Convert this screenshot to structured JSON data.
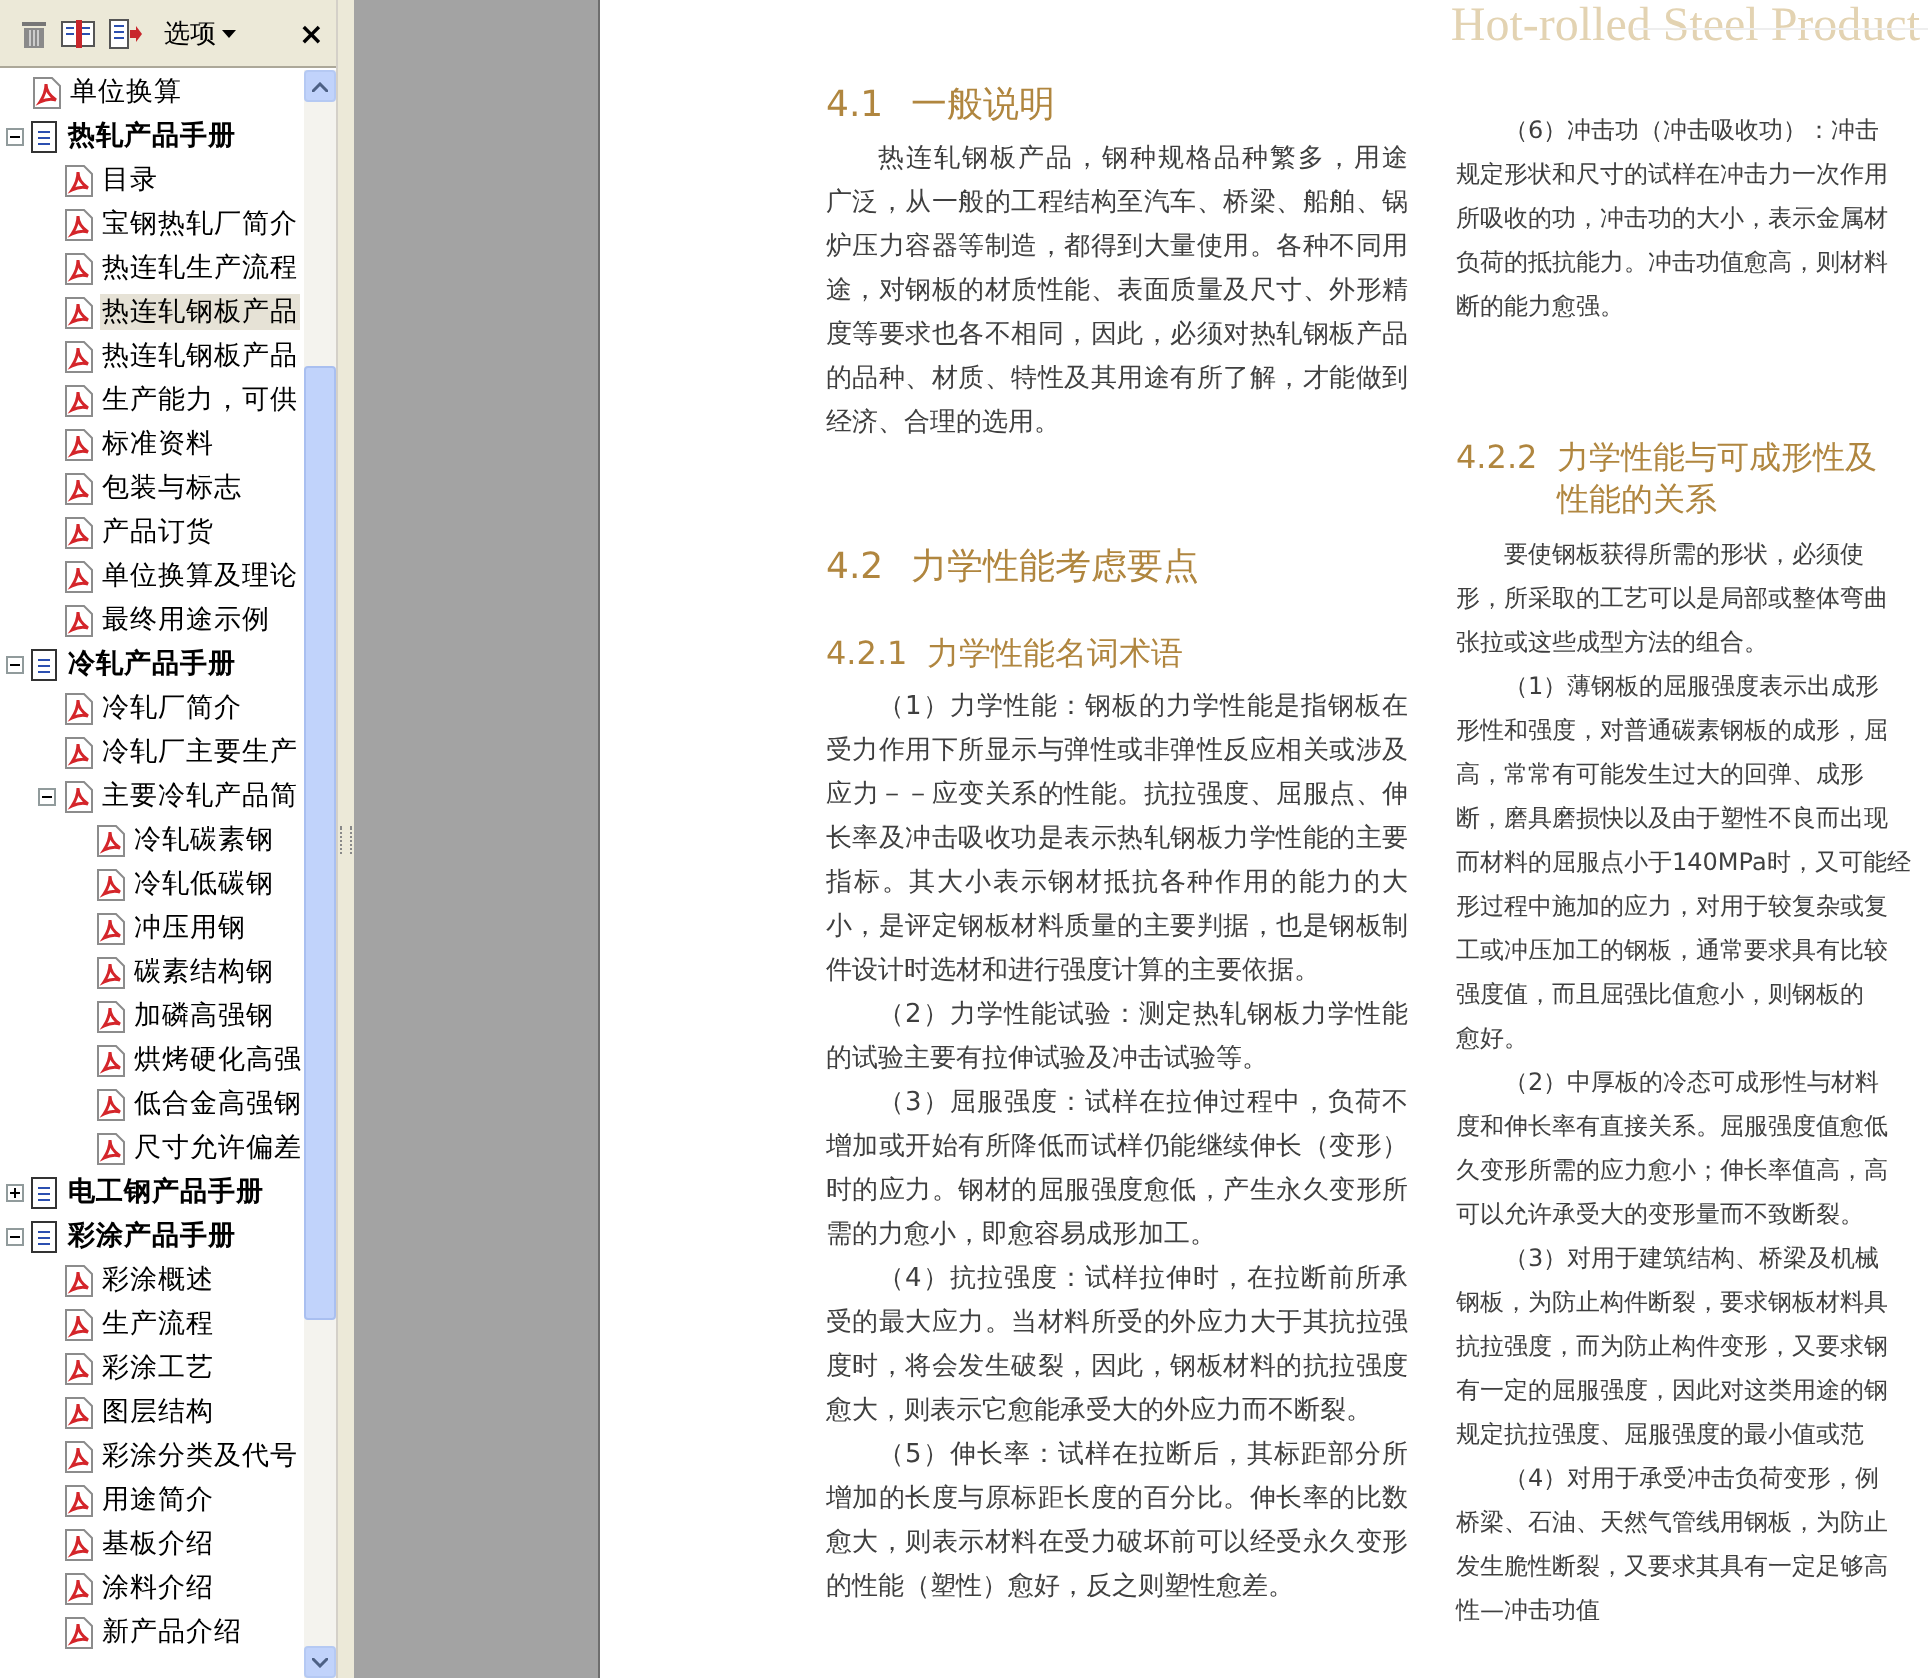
{
  "toolbar": {
    "options_menu": "选项",
    "close": "×"
  },
  "bookmarks": [
    {
      "label": "单位换算",
      "kind": "page",
      "selected": false
    },
    {
      "label": "热轧产品手册",
      "kind": "book",
      "selected": false,
      "expanded": true,
      "children": [
        {
          "label": "目录",
          "kind": "page",
          "selected": false
        },
        {
          "label": "宝钢热轧厂简介",
          "kind": "page",
          "selected": false
        },
        {
          "label": "热连轧生产流程",
          "kind": "page",
          "selected": false
        },
        {
          "label": "热连轧钢板产品",
          "kind": "page",
          "selected": true
        },
        {
          "label": "热连轧钢板产品",
          "kind": "page",
          "selected": false
        },
        {
          "label": "生产能力，可供",
          "kind": "page",
          "selected": false
        },
        {
          "label": "标准资料",
          "kind": "page",
          "selected": false
        },
        {
          "label": "包装与标志",
          "kind": "page",
          "selected": false
        },
        {
          "label": "产品订货",
          "kind": "page",
          "selected": false
        },
        {
          "label": "单位换算及理论",
          "kind": "page",
          "selected": false
        },
        {
          "label": "最终用途示例",
          "kind": "page",
          "selected": false
        }
      ]
    },
    {
      "label": "冷轧产品手册",
      "kind": "book",
      "selected": false,
      "expanded": true,
      "children": [
        {
          "label": "冷轧厂简介",
          "kind": "page",
          "selected": false
        },
        {
          "label": "冷轧厂主要生产",
          "kind": "page",
          "selected": false
        },
        {
          "label": "主要冷轧产品简",
          "kind": "page",
          "selected": false,
          "expanded": true,
          "children": [
            {
              "label": "冷轧碳素钢",
              "kind": "page",
              "selected": false
            },
            {
              "label": "冷轧低碳钢",
              "kind": "page",
              "selected": false
            },
            {
              "label": "冲压用钢",
              "kind": "page",
              "selected": false
            },
            {
              "label": "碳素结构钢",
              "kind": "page",
              "selected": false
            },
            {
              "label": "加磷高强钢",
              "kind": "page",
              "selected": false
            },
            {
              "label": "烘烤硬化高强",
              "kind": "page",
              "selected": false
            },
            {
              "label": "低合金高强钢",
              "kind": "page",
              "selected": false
            },
            {
              "label": "尺寸允许偏差",
              "kind": "page",
              "selected": false
            }
          ]
        }
      ]
    },
    {
      "label": "电工钢产品手册",
      "kind": "book",
      "selected": false,
      "expanded": false
    },
    {
      "label": "彩涂产品手册",
      "kind": "book",
      "selected": false,
      "expanded": true,
      "children": [
        {
          "label": "彩涂概述",
          "kind": "page",
          "selected": false
        },
        {
          "label": "生产流程",
          "kind": "page",
          "selected": false
        },
        {
          "label": "彩涂工艺",
          "kind": "page",
          "selected": false
        },
        {
          "label": "图层结构",
          "kind": "page",
          "selected": false
        },
        {
          "label": "彩涂分类及代号",
          "kind": "page",
          "selected": false
        },
        {
          "label": "用途简介",
          "kind": "page",
          "selected": false
        },
        {
          "label": "基板介绍",
          "kind": "page",
          "selected": false
        },
        {
          "label": "涂料介绍",
          "kind": "page",
          "selected": false
        },
        {
          "label": "新产品介绍",
          "kind": "page",
          "selected": false
        }
      ]
    }
  ],
  "page": {
    "running_header": "Hot-rolled Steel Product",
    "left_column": [
      {
        "kind": "section",
        "number": "4.1",
        "lines": [
          "一般说明"
        ]
      },
      {
        "kind": "paragraph",
        "lines": [
          "热连轧钢板产品，钢种规格品种繁多，用途",
          "广泛，从一般的工程结构至汽车、桥梁、船舶、锅",
          "炉压力容器等制造，都得到大量使用。各种不同用",
          "途，对钢板的材质性能、表面质量及尺寸、外形精",
          "度等要求也各不相同，因此，必须对热轧钢板产品",
          "的品种、材质、特性及其用途有所了解，才能做到",
          "经济、合理的选用。"
        ]
      },
      {
        "kind": "section",
        "number": "4.2",
        "lines": [
          "力学性能考虑要点"
        ]
      },
      {
        "kind": "subsection",
        "number": "4.2.1",
        "lines": [
          "力学性能名词术语"
        ]
      },
      {
        "kind": "paragraph",
        "lines": [
          "（1）力学性能：钢板的力学性能是指钢板在",
          "受力作用下所显示与弹性或非弹性反应相关或涉及",
          "应力－－应变关系的性能。抗拉强度、屈服点、伸",
          "长率及冲击吸收功是表示热轧钢板力学性能的主要",
          "指标。其大小表示钢材抵抗各种作用的能力的大",
          "小，是评定钢板材料质量的主要判据，也是钢板制",
          "件设计时选材和进行强度计算的主要依据。"
        ]
      },
      {
        "kind": "paragraph",
        "lines": [
          "（2）力学性能试验：测定热轧钢板力学性能",
          "的试验主要有拉伸试验及冲击试验等。"
        ]
      },
      {
        "kind": "paragraph",
        "lines": [
          "（3）屈服强度：试样在拉伸过程中，负荷不",
          "增加或开始有所降低而试样仍能继续伸长（变形）",
          "时的应力。钢材的屈服强度愈低，产生永久变形所",
          "需的力愈小，即愈容易成形加工。"
        ]
      },
      {
        "kind": "paragraph",
        "lines": [
          "（4）抗拉强度：试样拉伸时，在拉断前所承",
          "受的最大应力。当材料所受的外应力大于其抗拉强",
          "度时，将会发生破裂，因此，钢板材料的抗拉强度",
          "愈大，则表示它愈能承受大的外应力而不断裂。"
        ]
      },
      {
        "kind": "paragraph",
        "lines": [
          "（5）伸长率：试样在拉断后，其标距部分所",
          "增加的长度与原标距长度的百分比。伸长率的比数",
          "愈大，则表示材料在受力破坏前可以经受永久变形",
          "的性能（塑性）愈好，反之则塑性愈差。"
        ]
      }
    ],
    "right_column": [
      {
        "kind": "paragraph",
        "lines": [
          "（6）冲击功（冲击吸收功）：冲击",
          "规定形状和尺寸的试样在冲击力一次作用",
          "所吸收的功，冲击功的大小，表示金属材",
          "负荷的抵抗能力。冲击功值愈高，则材料",
          "断的能力愈强。"
        ]
      },
      {
        "kind": "subsection",
        "number": "4.2.2",
        "lines": [
          "力学性能与可成形性及",
          "性能的关系"
        ]
      },
      {
        "kind": "paragraph",
        "lines": [
          "要使钢板获得所需的形状，必须使",
          "形，所采取的工艺可以是局部或整体弯曲",
          "张拉或这些成型方法的组合。"
        ]
      },
      {
        "kind": "paragraph",
        "lines": [
          "（1）薄钢板的屈服强度表示出成形",
          "形性和强度，对普通碳素钢板的成形，屈",
          "高，常常有可能发生过大的回弹、成形",
          "断，磨具磨损快以及由于塑性不良而出现",
          "而材料的屈服点小于140MPa时，又可能经",
          "形过程中施加的应力，对用于较复杂或复",
          "工或冲压加工的钢板，通常要求具有比较",
          "强度值，而且屈强比值愈小，则钢板的",
          "愈好。"
        ]
      },
      {
        "kind": "paragraph",
        "lines": [
          "（2）中厚板的冷态可成形性与材料",
          "度和伸长率有直接关系。屈服强度值愈低",
          "久变形所需的应力愈小；伸长率值高，高",
          "可以允许承受大的变形量而不致断裂。"
        ]
      },
      {
        "kind": "paragraph",
        "lines": [
          "（3）对用于建筑结构、桥梁及机械",
          "钢板，为防止构件断裂，要求钢板材料具",
          "抗拉强度，而为防止构件变形，又要求钢",
          "有一定的屈服强度，因此对这类用途的钢",
          "规定抗拉强度、屈服强度的最小值或范"
        ]
      },
      {
        "kind": "paragraph",
        "lines": [
          "（4）对用于承受冲击负荷变形，例",
          "桥梁、石油、天然气管线用钢板，为防止",
          "发生脆性断裂，又要求其具有一定足够高",
          "性—冲击功值"
        ]
      }
    ]
  }
}
